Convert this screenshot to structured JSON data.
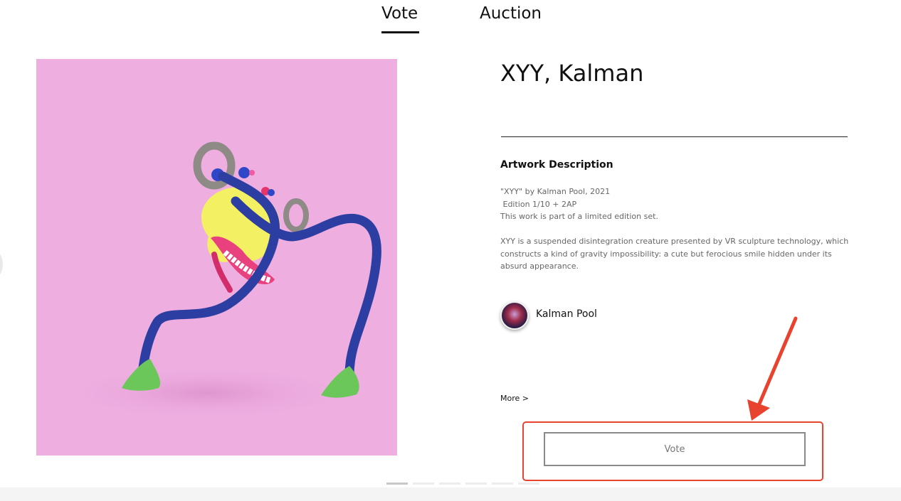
{
  "tabs": [
    {
      "label": "Vote",
      "active": true
    },
    {
      "label": "Auction",
      "active": false
    }
  ],
  "artwork": {
    "title": "XYY, Kalman",
    "image_subject": "pink-background-sculpture-creature"
  },
  "description": {
    "heading": "Artwork Description",
    "lines": [
      "\"XYY\" by Kalman Pool, 2021",
      " Edition 1/10 + 2AP",
      "This work is part of a limited edition set."
    ],
    "paragraph": "XYY is a suspended disintegration creature presented by VR sculpture technology, which constructs a kind of gravity impossibility: a cute but ferocious smile hidden under its absurd appearance."
  },
  "artist": {
    "name": "Kalman Pool"
  },
  "more_label": "More >",
  "vote_button_label": "Vote",
  "pager": {
    "count": 6,
    "active_index": 0
  },
  "colors": {
    "artwork_background": "#eeaee0",
    "annotation_highlight": "#e8432e",
    "vote_button_border": "#8a8a8a"
  }
}
